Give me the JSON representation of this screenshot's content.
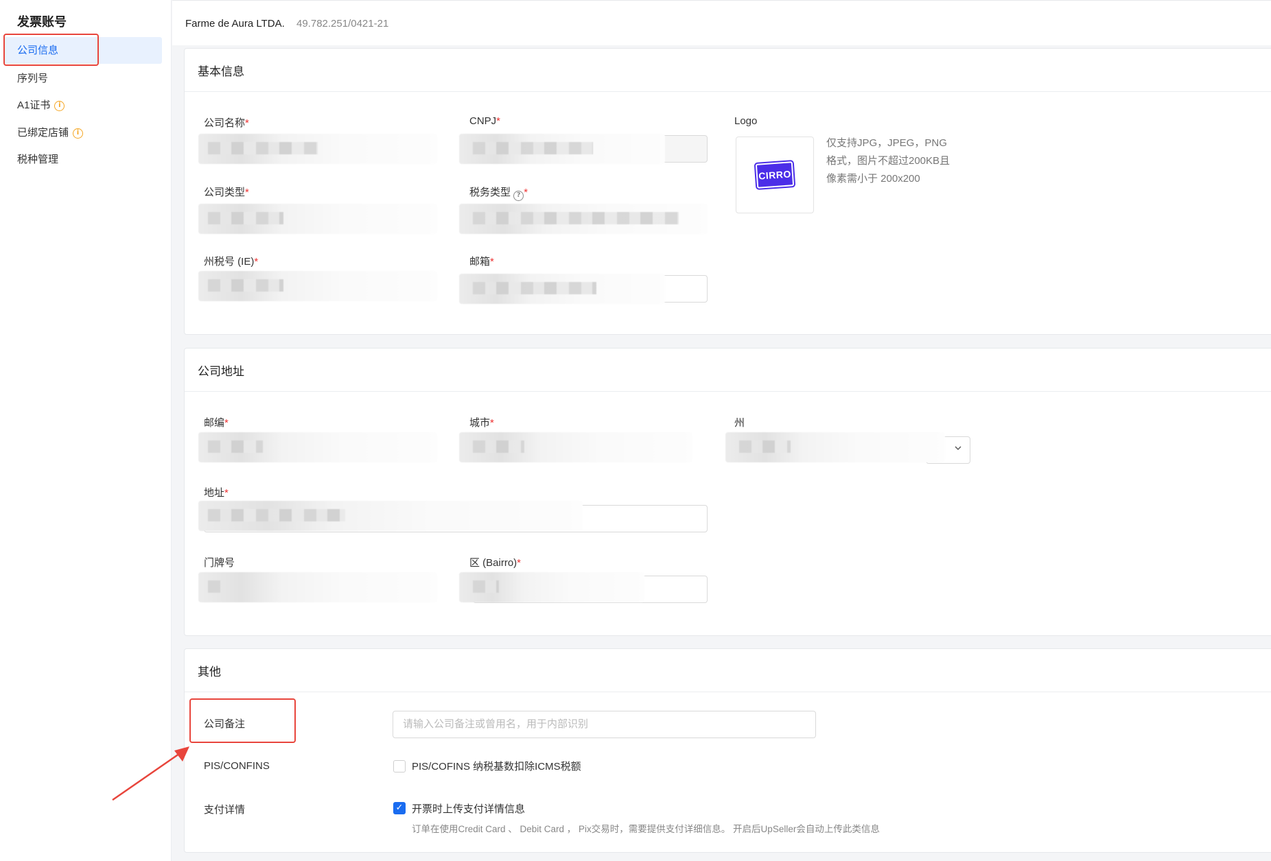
{
  "sidebar": {
    "title": "发票账号",
    "items": [
      {
        "label": "公司信息",
        "active": true
      },
      {
        "label": "序列号"
      },
      {
        "label": "A1证书",
        "badge": "i"
      },
      {
        "label": "已绑定店铺",
        "badge": "i"
      },
      {
        "label": "税种管理"
      }
    ]
  },
  "topbar": {
    "company": "Farme de Aura LTDA.",
    "cnpj": "49.782.251/0421-21"
  },
  "basic": {
    "title": "基本信息",
    "company_name_label": "公司名称",
    "cnpj_label": "CNPJ",
    "logo_label": "Logo",
    "logo_text": "CIRRO",
    "logo_hint": [
      "仅支持JPG，JPEG，PNG",
      "格式，图片不超过200KB且",
      "像素需小于 200x200"
    ],
    "company_type_label": "公司类型",
    "tax_type_label": "税务类型",
    "state_tax_label": "州税号 (IE)",
    "email_label": "邮箱",
    "required_mark": "*",
    "help_icon": "?"
  },
  "address": {
    "title": "公司地址",
    "zip_label": "邮编",
    "city_label": "城市",
    "state_label": "州",
    "address_label": "地址",
    "number_label": "门牌号",
    "district_label": "区 (Bairro)"
  },
  "other": {
    "title": "其他",
    "remark_label": "公司备注",
    "remark_placeholder": "请输入公司备注或曾用名，用于内部识别",
    "pis_label": "PIS/CONFINS",
    "pis_checkbox_label": "PIS/COFINS 纳税基数扣除ICMS税额",
    "pis_checked": false,
    "payment_label": "支付详情",
    "payment_checkbox_label": "开票时上传支付详情信息",
    "payment_checked": true,
    "payment_hint": "订单在使用Credit Card 、 Debit Card ， Pix交易时，需要提供支付详细信息。 开启后UpSeller会自动上传此类信息",
    "check_mark": "✓"
  },
  "colors": {
    "accent": "#1a6cf0",
    "highlight": "#e8453c",
    "required": "#e33",
    "warning": "#f5a623",
    "logo_bg": "#4b2ee8"
  }
}
